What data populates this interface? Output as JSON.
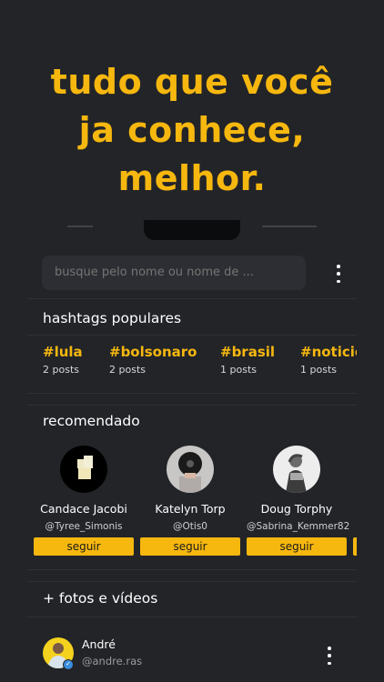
{
  "promo": {
    "line1": "tudo que você",
    "line2": "ja conhece,",
    "line3": "melhor."
  },
  "search": {
    "placeholder": "busque pelo nome ou nome de ..."
  },
  "hashtags_section": {
    "title": "hashtags populares",
    "items": [
      {
        "tag": "#lula",
        "count": "2 posts"
      },
      {
        "tag": "#bolsonaro",
        "count": "2 posts"
      },
      {
        "tag": "#brasil",
        "count": "1 posts"
      },
      {
        "tag": "#noticic",
        "count": "1 posts"
      }
    ]
  },
  "recommended_section": {
    "title": "recomendado",
    "users": [
      {
        "name": "Candace Jacobi",
        "handle": "@Tyree_Simonis",
        "follow_label": "seguir"
      },
      {
        "name": "Katelyn Torp",
        "handle": "@Otis0",
        "follow_label": "seguir"
      },
      {
        "name": "Doug Torphy",
        "handle": "@Sabrina_Kemmer82",
        "follow_label": "seguir"
      }
    ]
  },
  "media_section": {
    "title": "+ fotos e vídeos"
  },
  "post": {
    "author_name": "André",
    "author_handle": "@andre.ras"
  },
  "colors": {
    "background": "#222428",
    "accent": "#f6b70f",
    "search_bg": "#2c2e33"
  },
  "icons": {
    "menu": "kebab-menu-icon",
    "verified": "verified-badge-icon"
  }
}
